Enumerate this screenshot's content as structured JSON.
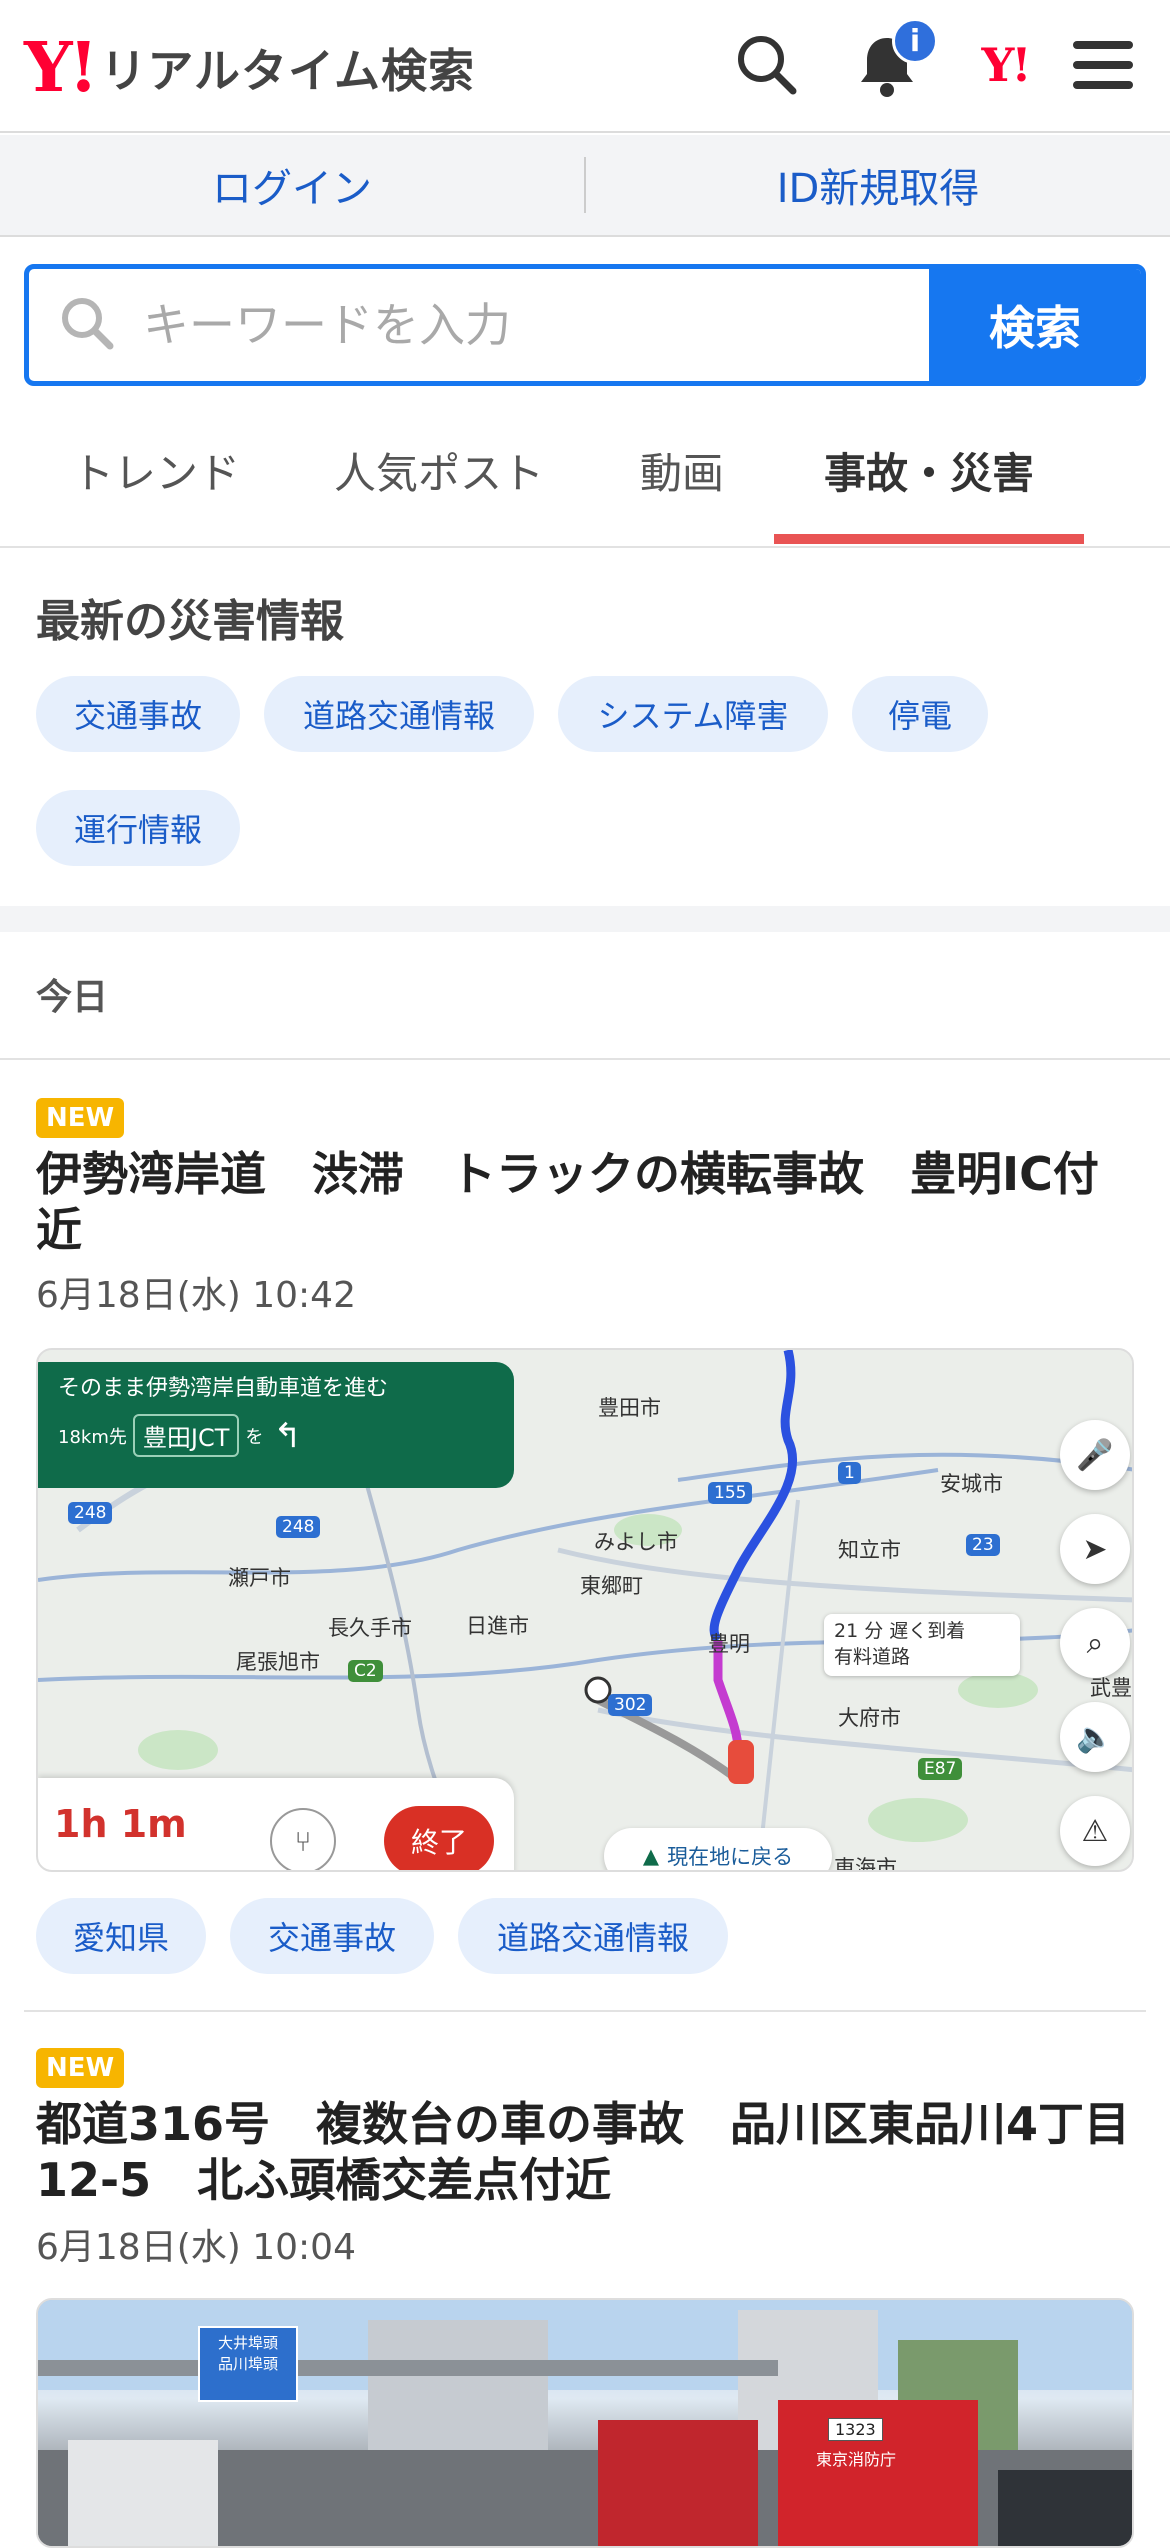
{
  "header": {
    "logo_mark": "Y!",
    "logo_text": "リアルタイム検索",
    "notification_badge": "i",
    "yahoo_mark": "Y!"
  },
  "auth": {
    "login": "ログイン",
    "register": "ID新規取得"
  },
  "search": {
    "placeholder": "キーワードを入力",
    "button": "検索"
  },
  "tabs": [
    {
      "label": "トレンド"
    },
    {
      "label": "人気ポスト"
    },
    {
      "label": "動画"
    },
    {
      "label": "事故・災害"
    }
  ],
  "active_tab": "事故・災害",
  "disaster": {
    "title": "最新の災害情報",
    "chips": [
      {
        "label": "交通事故"
      },
      {
        "label": "道路交通情報"
      },
      {
        "label": "システム障害"
      },
      {
        "label": "停電"
      },
      {
        "label": "運行情報"
      }
    ]
  },
  "section": {
    "today": "今日"
  },
  "articles": [
    {
      "badge": "NEW",
      "title": "伊勢湾岸道　渋滞　トラックの横転事故　豊明IC付近",
      "date": "6月18日(水) 10:42",
      "tags": [
        {
          "label": "愛知県"
        },
        {
          "label": "交通事故"
        },
        {
          "label": "道路交通情報"
        }
      ],
      "map": {
        "nav_instruction": "そのまま伊勢湾岸自動車道を進む",
        "nav_distance": "18km先",
        "nav_junction": "豊田JCT",
        "nav_suffix": "を",
        "eta": "1h 1m",
        "end_button": "終了",
        "recenter": "現在地に戻る",
        "delay_line1": "21 分 遅く到着",
        "delay_line2": "有料道路",
        "places": {
          "toyota": "豊田市",
          "anjo": "安城市",
          "miyoshi": "みよし市",
          "chiryu": "知立市",
          "seto": "瀬戸市",
          "togo": "東郷町",
          "nagakute": "長久手市",
          "nisshin": "日進市",
          "owariasahi": "尾張旭市",
          "toyoake": "豊明",
          "obu": "大府市",
          "tokai": "東海市",
          "takeda": "武豊"
        },
        "routes": {
          "r248a": "248",
          "r248b": "248",
          "r155": "155",
          "r1": "1",
          "r23": "23",
          "r302": "302",
          "c2": "C2",
          "e87": "E87"
        }
      }
    },
    {
      "badge": "NEW",
      "title": "都道316号　複数台の車の事故　品川区東品川4丁目12-5　北ふ頭橋交差点付近",
      "date": "6月18日(水) 10:04",
      "photo": {
        "sign_line1": "大井埠頭",
        "sign_line2": "品川埠頭",
        "plate": "1323",
        "station": "東京消防庁"
      }
    }
  ],
  "colors": {
    "brand_red": "#ff0033",
    "link_blue": "#1a5cc8",
    "search_blue": "#1677f0",
    "tab_underline": "#e95454",
    "chip_bg": "#e6effc",
    "new_badge": "#f7b500"
  }
}
